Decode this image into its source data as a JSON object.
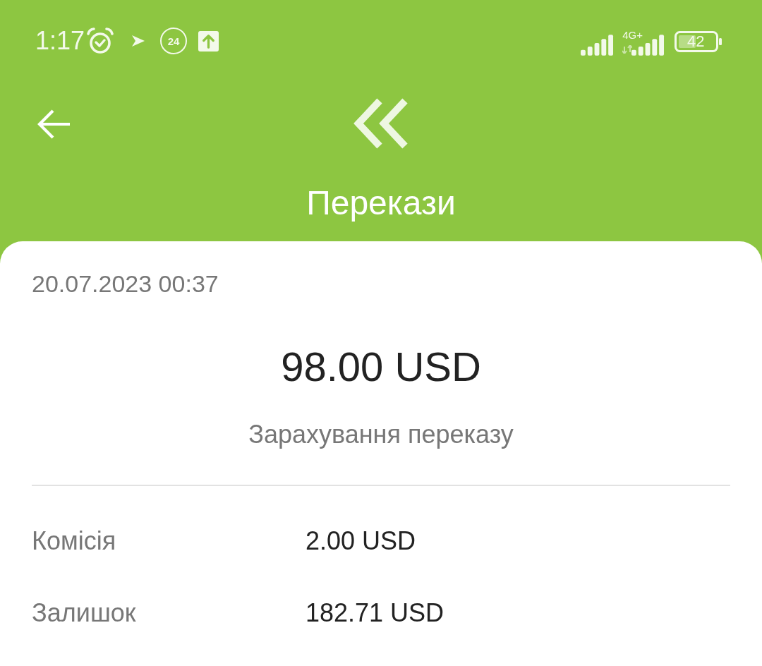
{
  "status_bar": {
    "time": "1:17",
    "badge": "24",
    "network": "4G+",
    "battery": "42"
  },
  "header": {
    "title": "Перекази"
  },
  "transaction": {
    "datetime": "20.07.2023 00:37",
    "amount": "98.00 USD",
    "description": "Зарахування переказу",
    "details": [
      {
        "label": "Комісія",
        "value": "2.00 USD"
      },
      {
        "label": "Залишок",
        "value": "182.71 USD"
      }
    ]
  }
}
